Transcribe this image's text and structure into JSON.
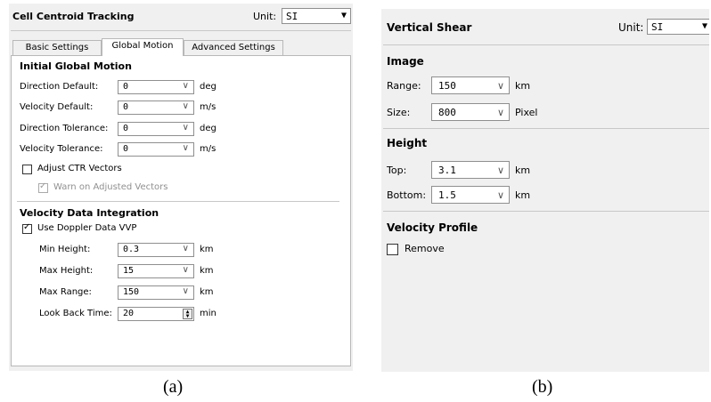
{
  "panel_a": {
    "title": "Cell Centroid Tracking",
    "unit_label": "Unit:",
    "unit_value": "SI",
    "tabs": [
      {
        "label": "Basic Settings",
        "active": false
      },
      {
        "label": "Global Motion",
        "active": true
      },
      {
        "label": "Advanced Settings",
        "active": false
      }
    ],
    "initial_global_motion": {
      "heading": "Initial Global Motion",
      "fields": [
        {
          "label": "Direction Default:",
          "value": "0",
          "unit": "deg"
        },
        {
          "label": "Velocity Default:",
          "value": "0",
          "unit": "m/s"
        },
        {
          "label": "Direction Tolerance:",
          "value": "0",
          "unit": "deg"
        },
        {
          "label": "Velocity Tolerance:",
          "value": "0",
          "unit": "m/s"
        }
      ],
      "adjust_ctr": {
        "label": "Adjust CTR Vectors",
        "checked": false
      },
      "warn_adjusted": {
        "label": "Warn on Adjusted Vectors",
        "checked": true,
        "disabled": true
      }
    },
    "velocity_data_integration": {
      "heading": "Velocity Data Integration",
      "use_doppler": {
        "label": "Use Doppler Data VVP",
        "checked": true
      },
      "fields": [
        {
          "label": "Min Height:",
          "value": "0.3",
          "unit": "km"
        },
        {
          "label": "Max Height:",
          "value": "15",
          "unit": "km"
        },
        {
          "label": "Max Range:",
          "value": "150",
          "unit": "km"
        }
      ],
      "look_back": {
        "label": "Look Back Time:",
        "value": "20",
        "unit": "min"
      }
    },
    "caption": "(a)"
  },
  "panel_b": {
    "title": "Vertical Shear",
    "unit_label": "Unit:",
    "unit_value": "SI",
    "image": {
      "heading": "Image",
      "fields": [
        {
          "label": "Range:",
          "value": "150",
          "unit": "km"
        },
        {
          "label": "Size:",
          "value": "800",
          "unit": "Pixel"
        }
      ]
    },
    "height": {
      "heading": "Height",
      "fields": [
        {
          "label": "Top:",
          "value": "3.1",
          "unit": "km"
        },
        {
          "label": "Bottom:",
          "value": "1.5",
          "unit": "km"
        }
      ]
    },
    "velocity_profile": {
      "heading": "Velocity Profile",
      "remove": {
        "label": "Remove",
        "checked": false
      }
    },
    "caption": "(b)"
  },
  "glyphs": {
    "dropdown_arrow": "▼",
    "chevron": "∨",
    "check": "✓",
    "spin_up": "▲",
    "spin_down": "▼"
  }
}
